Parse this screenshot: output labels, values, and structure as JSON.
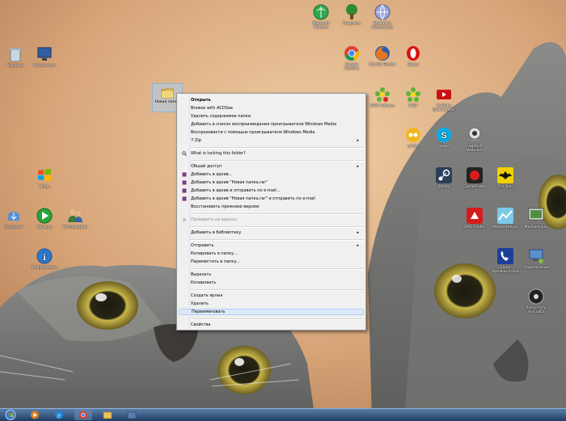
{
  "desktop": {
    "icons": [
      {
        "label": "Корзина",
        "icon": "recycle-bin-icon"
      },
      {
        "label": "Компьютер",
        "icon": "computer-icon"
      },
      {
        "label": "Microsoft Modern",
        "icon": "network-icon"
      },
      {
        "label": "Programs",
        "icon": "tree-icon"
      },
      {
        "label": "Student's Documents",
        "icon": "globe-icon"
      },
      {
        "label": "Google Chrome",
        "icon": "chrome-icon"
      },
      {
        "label": "Mozilla Firefox",
        "icon": "firefox-icon"
      },
      {
        "label": "Opera",
        "icon": "opera-icon"
      },
      {
        "label": "ICQ7 Infinum",
        "icon": "icq-flower-icon"
      },
      {
        "label": "ICQ7",
        "icon": "icq-icon"
      },
      {
        "label": "YouTube Downloader",
        "icon": "youtube-downloader-icon"
      },
      {
        "label": "ooVoo",
        "icon": "oovoo-icon"
      },
      {
        "label": "Skype",
        "icon": "skype-icon"
      },
      {
        "label": "Logitech Webcam",
        "icon": "webcam-icon"
      },
      {
        "label": "Steam",
        "icon": "steam-icon"
      },
      {
        "label": "GameFrame",
        "icon": "game-icon"
      },
      {
        "label": "The Bat!",
        "icon": "bat-icon"
      },
      {
        "label": "Игры",
        "icon": "windows-flag-icon"
      },
      {
        "label": "Загрузки",
        "icon": "downloads-icon"
      },
      {
        "label": "Музыка",
        "icon": "media-player-icon"
      },
      {
        "label": "Фотографии",
        "icon": "users-icon"
      },
      {
        "label": "SMS Trader",
        "icon": "sms-icon"
      },
      {
        "label": "ModemHelper",
        "icon": "modem-icon"
      },
      {
        "label": "MediaHelper",
        "icon": "media-helper-icon"
      },
      {
        "label": "Информация",
        "icon": "info-icon"
      },
      {
        "label": "Sipex Speakerphone",
        "icon": "phone-icon"
      },
      {
        "label": "Подключение",
        "icon": "network-connection-icon"
      },
      {
        "label": "Запустить VirtualDJ",
        "icon": "virtualdj-icon"
      }
    ],
    "selected_folder": {
      "label": "Новая папка"
    }
  },
  "context_menu": {
    "items": [
      {
        "label": "Открыть",
        "style": "bold"
      },
      {
        "label": "Browse with ACDSee"
      },
      {
        "label": "Удалить содержимое папки"
      },
      {
        "label": "Добавить в список воспроизведения проигрывателя Windows Media"
      },
      {
        "label": "Воспроизвести с помощью проигрывателя Windows Media"
      },
      {
        "label": "7-Zip",
        "submenu": true
      },
      {
        "label": "What is locking this folder?",
        "icon": "search-icon"
      },
      {
        "label": "Общий доступ",
        "submenu": true
      },
      {
        "label": "Добавить в архив...",
        "icon": "winrar-icon"
      },
      {
        "label": "Добавить в архив \"Новая папка.rar\"",
        "icon": "winrar-icon"
      },
      {
        "label": "Добавить в архив и отправить по e-mail...",
        "icon": "winrar-icon"
      },
      {
        "label": "Добавить в архив \"Новая папка.rar\" и отправить по e-mail",
        "icon": "winrar-icon"
      },
      {
        "label": "Восстановить прежнюю версию"
      },
      {
        "label": "Проверить на вирусы",
        "style": "disabled",
        "icon": "antivirus-icon"
      },
      {
        "label": "Добавить в библиотеку",
        "submenu": true
      },
      {
        "label": "Отправить",
        "submenu": true
      },
      {
        "label": "Копировать в папку..."
      },
      {
        "label": "Переместить в папку..."
      },
      {
        "label": "Вырезать"
      },
      {
        "label": "Копировать"
      },
      {
        "label": "Создать ярлык"
      },
      {
        "label": "Удалить"
      },
      {
        "label": "Переименовать",
        "style": "hover"
      },
      {
        "label": "Свойства"
      }
    ],
    "submenu_arrow": "▸"
  },
  "taskbar": {
    "items": [
      "start-orb-icon",
      "media-player-icon",
      "internet-explorer-icon",
      "chrome-icon",
      "explorer-icon",
      "taskbar-app-icon"
    ]
  },
  "colors": {
    "menu_bg": "#f0f0f0",
    "hover_bg": "#dde9f8",
    "taskbar": "#2a4a74"
  }
}
